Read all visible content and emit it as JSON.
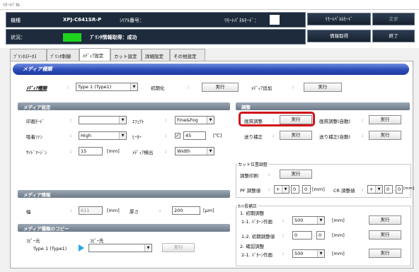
{
  "window": {
    "title": "ﾘﾓｰﾄﾊﾟﾈﾙ"
  },
  "top": {
    "model_label": "機種",
    "model_value": "XPJ-C641SR-P",
    "serial_label": "ｼﾘｱﾙ番号：",
    "remote_mode_label": "ﾘﾓｰﾄﾊﾟﾈﾙﾓｰﾄﾞ：",
    "status_label": "状況：",
    "status_value": "ﾌﾟﾘﾝﾀ情報取得：成功",
    "status_color": "#1dd31d",
    "btn_remote_mode": "ﾘﾓｰﾄﾊﾟﾈﾙﾓｰﾄﾞ",
    "btn_change": "変更",
    "btn_info": "情報取得",
    "btn_exit": "終了"
  },
  "tabs": [
    "ﾌﾟﾘﾝﾀｽﾃｰﾀｽ",
    "ﾌﾟﾘﾝﾀ制御",
    "ﾒﾃﾞｨｱ設定",
    "カット設定",
    "詳細設定",
    "その他設定"
  ],
  "media_type_section": {
    "title": "メディア種類",
    "media_type_label": "ﾒﾃﾞｨｱ種類",
    "media_type_value": "Type 1 (Type1)",
    "init_label": "初期化",
    "run": "実行",
    "add_label": "ﾒﾃﾞｨｱ追加"
  },
  "media_settings": {
    "title": "メディア設定",
    "print_mode_label": "印画ﾓｰﾄﾞ",
    "print_mode_value": "",
    "effect_label": "ｴﾌｪｸﾄ",
    "effect_value": "Fine&Fog",
    "fan_label": "吸着ﾌｧﾝ",
    "fan_value": "High",
    "heater_label": "ﾋｰﾀｰ",
    "heater_checked": "✓",
    "heater_value": "45",
    "heater_unit": "[℃]",
    "side_margin_label": "ｻｲﾄﾞﾏｰｼﾞﾝ",
    "side_margin_value": "15",
    "mm": "[mm]",
    "media_detect_label": "ﾒﾃﾞｨｱ検出",
    "media_detect_value": "Width"
  },
  "adjust": {
    "title": "調整",
    "image_adjust_label": "画質調整",
    "image_auto_label": "画質調整(自動)",
    "feed_label": "送り補正",
    "feed_auto_label": "送り補正(自動)",
    "run": "実行"
  },
  "cut_position": {
    "legend": "カット位置調整",
    "print_label": "調整印刷",
    "run": "実行",
    "pf_label": "PF 調整値",
    "pf_sign": "+",
    "pf_int": "0",
    "pf_dec": "0",
    "cr_label": "CR 調整値",
    "cr_sign": "+",
    "cr_int": "0",
    "cr_dec": "0",
    "mm": "[mm]"
  },
  "cut_length": {
    "legend": "ｶｯﾄ長補正",
    "init_adjust": "1. 初期調整",
    "item_1_1": "1-1. ﾊﾟﾀｰﾝ作画",
    "item_1_1_value": "500",
    "item_1_2": "1-2. 初期調整値",
    "item_1_2_int": "0",
    "item_1_2_dec": "0",
    "confirm_adjust": "2. 確認調整",
    "item_2_1": "2-1. ﾊﾟﾀｰﾝ作画",
    "item_2_1_value": "500",
    "mm": "[mm]",
    "run": "実行"
  },
  "media_info": {
    "title": "メディア情報",
    "width_label": "幅",
    "width_value": "611",
    "mm": "[mm]",
    "thickness_label": "厚さ",
    "thickness_value": "200",
    "um": "[μm]"
  },
  "media_copy": {
    "title": "メディア種類のコピー",
    "from_label": "ｺﾋﾟｰ元",
    "from_value": "Type 1 (Type1)",
    "to_label": "ｺﾋﾟｰ先",
    "to_value": "",
    "run": "実行"
  }
}
